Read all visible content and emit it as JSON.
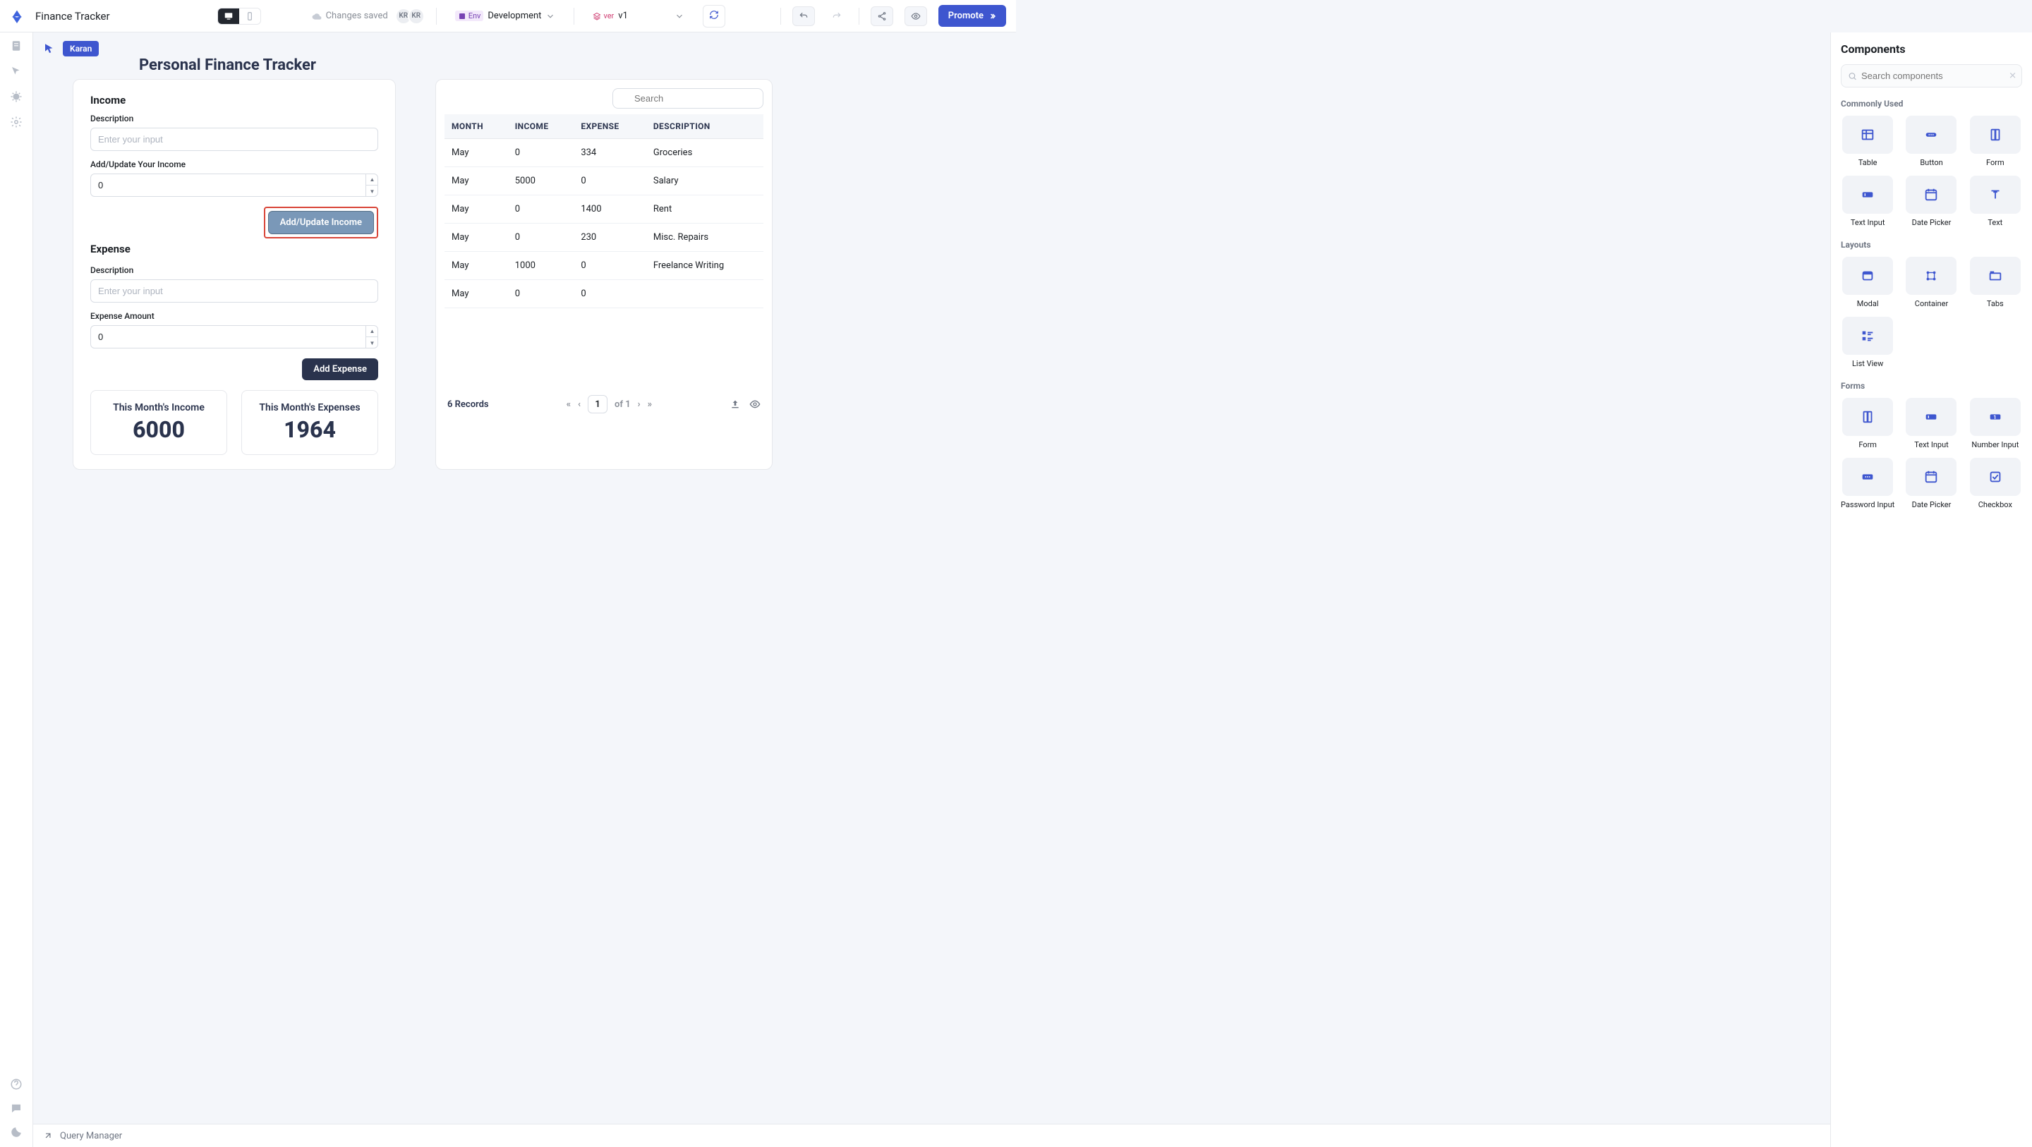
{
  "topbar": {
    "app_name": "Finance Tracker",
    "saved_text": "Changes saved",
    "avatars": [
      "KR",
      "KR"
    ],
    "env_badge": "Env",
    "env_value": "Development",
    "ver_badge": "ver",
    "ver_value": "v1",
    "promote": "Promote"
  },
  "cursor_user": "Karan",
  "workspace": {
    "title": "Personal Finance Tracker",
    "income": {
      "section": "Income",
      "desc_label": "Description",
      "desc_placeholder": "Enter your input",
      "amount_label": "Add/Update Your Income",
      "amount_value": "0",
      "button": "Add/Update Income"
    },
    "expense": {
      "section": "Expense",
      "desc_label": "Description",
      "desc_placeholder": "Enter your input",
      "amount_label": "Expense Amount",
      "amount_value": "0",
      "button": "Add Expense"
    },
    "summary": {
      "income_label": "This Month's Income",
      "income_value": "6000",
      "expense_label": "This Month's Expenses",
      "expense_value": "1964"
    }
  },
  "table": {
    "search_placeholder": "Search",
    "columns": [
      "MONTH",
      "INCOME",
      "EXPENSE",
      "DESCRIPTION"
    ],
    "rows": [
      {
        "month": "May",
        "income": "0",
        "expense": "334",
        "desc": "Groceries"
      },
      {
        "month": "May",
        "income": "5000",
        "expense": "0",
        "desc": "Salary"
      },
      {
        "month": "May",
        "income": "0",
        "expense": "1400",
        "desc": "Rent"
      },
      {
        "month": "May",
        "income": "0",
        "expense": "230",
        "desc": "Misc. Repairs"
      },
      {
        "month": "May",
        "income": "1000",
        "expense": "0",
        "desc": "Freelance Writing"
      },
      {
        "month": "May",
        "income": "0",
        "expense": "0",
        "desc": ""
      }
    ],
    "record_count": "6 Records",
    "page_num": "1",
    "page_of": "of 1"
  },
  "rightpanel": {
    "title": "Components",
    "search_placeholder": "Search components",
    "sections": [
      {
        "title": "Commonly Used",
        "items": [
          "Table",
          "Button",
          "Form",
          "Text Input",
          "Date Picker",
          "Text"
        ]
      },
      {
        "title": "Layouts",
        "items": [
          "Modal",
          "Container",
          "Tabs",
          "List View"
        ]
      },
      {
        "title": "Forms",
        "items": [
          "Form",
          "Text Input",
          "Number Input",
          "Password Input",
          "Date Picker",
          "Checkbox"
        ]
      }
    ]
  },
  "bottombar": {
    "query_manager": "Query Manager"
  }
}
